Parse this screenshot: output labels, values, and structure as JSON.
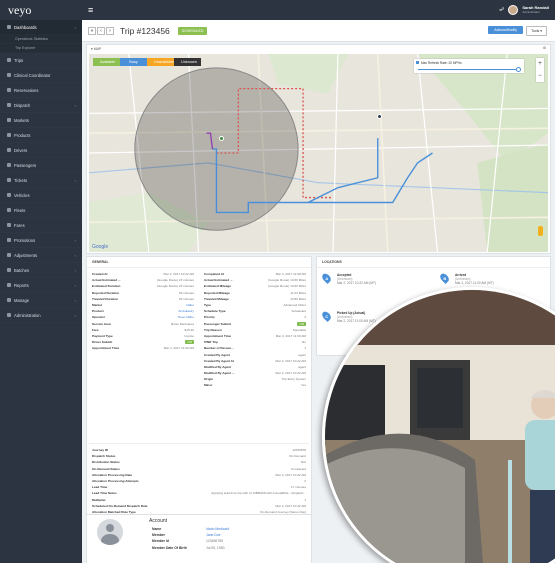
{
  "app": {
    "logo": "veyo",
    "menu_icon": "menu-icon"
  },
  "user": {
    "name": "Sarah Randall",
    "role": "Administrator"
  },
  "sidebar": {
    "items": [
      {
        "label": "Dashboards",
        "icon": "dashboard-icon",
        "active": true
      },
      {
        "label": "Operations Statistics",
        "sub": true
      },
      {
        "label": "Trip Explorer",
        "sub": true
      },
      {
        "label": "Trips",
        "icon": "trips-icon"
      },
      {
        "label": "Clinical Coordinator",
        "icon": "clinical-icon"
      },
      {
        "label": "Reservations",
        "icon": "reservations-icon"
      },
      {
        "label": "Dispatch",
        "icon": "dispatch-icon",
        "chev": true
      },
      {
        "label": "Markets",
        "icon": "markets-icon"
      },
      {
        "label": "Products",
        "icon": "products-icon"
      },
      {
        "label": "Drivers",
        "icon": "drivers-icon"
      },
      {
        "label": "Passengers",
        "icon": "passengers-icon"
      },
      {
        "label": "Tickets",
        "icon": "tickets-icon",
        "chev": true
      },
      {
        "label": "Vehicles",
        "icon": "vehicles-icon"
      },
      {
        "label": "Fleets",
        "icon": "fleets-icon"
      },
      {
        "label": "Fares",
        "icon": "fares-icon"
      },
      {
        "label": "Promotions",
        "icon": "promotions-icon",
        "chev": true
      },
      {
        "label": "Adjustments",
        "icon": "adjustments-icon",
        "chev": true
      },
      {
        "label": "Batches",
        "icon": "batches-icon",
        "chev": true
      },
      {
        "label": "Reports",
        "icon": "reports-icon",
        "chev": true
      },
      {
        "label": "Manage",
        "icon": "manage-icon",
        "chev": true
      },
      {
        "label": "Administration",
        "icon": "administration-icon",
        "chev": true
      }
    ]
  },
  "header": {
    "title": "Trip #123456",
    "status": "SCHEDULED",
    "action": "Actions/Modify",
    "tools": "Tools"
  },
  "map": {
    "panel_title": "MAP",
    "toggles": [
      {
        "label": "Available",
        "color": "#8cc152"
      },
      {
        "label": "Busy",
        "color": "#4a90d9"
      },
      {
        "label": "Unavailable",
        "color": "#f6a623"
      },
      {
        "label": "Unknown",
        "color": "#333333"
      }
    ],
    "speed_label": "Max Refresh Rate: 20 MPHs",
    "google": "Google",
    "zoom_in": "+",
    "zoom_out": "−"
  },
  "general": {
    "title": "GENERAL",
    "col1": [
      [
        "Created At",
        "Mar 2, 2017 10:22 AM"
      ],
      [
        "Actual Estimated ...",
        "(Google Route) 23 minutes"
      ],
      [
        "Estimated Duration",
        "(Google Route) 23 minutes"
      ],
      [
        "Reported Duration",
        "39 minutes"
      ],
      [
        "Traveled Duration",
        "39 minutes"
      ],
      [
        "Market",
        "Idaho"
      ],
      [
        "Product",
        "Ambulatory"
      ],
      [
        "Operator",
        "Tleen Idaho"
      ],
      [
        "Service Area",
        "Boise Metroarea"
      ],
      [
        "Fare",
        "$15.40"
      ],
      [
        "Payment Type",
        "Invoice"
      ],
      [
        "Driver Submit",
        "ON"
      ],
      [
        "Appointment Time",
        "Mar 2, 2017 11:00 AM"
      ]
    ],
    "col2": [
      [
        "Completed At",
        "Mar 2, 2017 11:08 AM"
      ],
      [
        "Actual Estimated ...",
        "(Google Route) 10.66 Miles"
      ],
      [
        "Estimated Mileage",
        "(Google Route) 10.66 Miles"
      ],
      [
        "Reported Mileage",
        "11.03 Miles"
      ],
      [
        "Traveled Mileage",
        "10.80 Miles"
      ],
      [
        "Type",
        "Advanced Order"
      ],
      [
        "Schedule Type",
        "Scheduled"
      ],
      [
        "Priority",
        "3"
      ],
      [
        "Passenger Submit",
        "ON"
      ],
      [
        "Trip Reason",
        "Specialist"
      ],
      [
        "Appointment Time",
        "Mar 2, 2017 11:00 AM"
      ],
      [
        "IVNR Trip",
        "No"
      ],
      [
        "Number of Passen...",
        "1"
      ],
      [
        "Created By Agent",
        "agent"
      ],
      [
        "Created By Agent At",
        "Mar 2, 2017 10:22 AM"
      ],
      [
        "Modified By Agent",
        "agent"
      ],
      [
        "Modified By Agent ...",
        "Mar 2, 2017 10:22 AM"
      ],
      [
        "Origin",
        "Trip Entry System"
      ],
      [
        "Minor",
        "Yes"
      ]
    ],
    "wide": [
      [
        "Journey ID",
        "12345678"
      ],
      [
        "Dispatch Status",
        "On-Demand"
      ],
      [
        "Distribution Status",
        "N/A"
      ],
      [
        "On-Demand Status",
        "Completed"
      ],
      [
        "Allocation Processing Date",
        "Mar 2, 2017 10:22 AM"
      ],
      [
        "Allocation Processing Attempts",
        "2"
      ],
      [
        "Lead Time",
        "17 minutes"
      ],
      [
        "Lead Time Notes",
        "Applying lead time trip with Id 14BB4D8 with AnnualRide - Dispatch..."
      ],
      [
        "Multiplier",
        "1"
      ],
      [
        "Scheduled On-Demand Dispatch Date",
        "Mar 2, 2017 10:42 AM"
      ],
      [
        "Allocation Matched Rule Type",
        "On-Demand Journey (Same Day)"
      ],
      [
        "Allocation Matched Rule Description",
        "Name: On-Demand Journey (Same Day), Order: 25, Type: Per Trip Ord..."
      ],
      [
        "Allocation Exception Type",
        "None"
      ]
    ]
  },
  "locations": {
    "title": "LOCATIONS",
    "items": [
      {
        "letter": "A",
        "title": "Accepted",
        "sub": "(Unknown)",
        "time": "Mar 2, 2017 10:22 AM (MT)",
        "color": "#4a90d9"
      },
      {
        "letter": "B",
        "title": "Arrived",
        "sub": "(Unknown)",
        "time": "Mar 2, 2017 11:00 AM (MT)",
        "color": "#4a90d9"
      },
      {
        "letter": "C",
        "title": "Picked Up (Actual)",
        "sub": "(Unknown)",
        "time": "Mar 2, 2017 11:00 AM (MT)",
        "color": "#4a90d9"
      },
      {
        "letter": "D",
        "title": "Dropped Off (Actual)",
        "sub": "(Unknown)",
        "time": "Mar 2, 2017 11:08 AM (MT)",
        "color": "#4a90d9"
      }
    ]
  },
  "account": {
    "title": "Account",
    "rows": [
      [
        "Name",
        "Idaho Medicaid"
      ],
      [
        "Member",
        "Jane Doe"
      ],
      [
        "Member Id",
        "123456789"
      ],
      [
        "Member Date Of Birth",
        "Jul 05, 1950"
      ]
    ]
  }
}
